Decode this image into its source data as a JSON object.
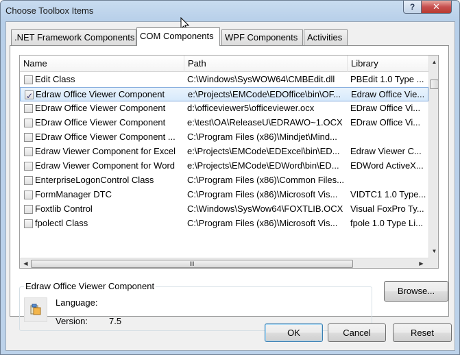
{
  "window": {
    "title": "Choose Toolbox Items",
    "help_label": "?",
    "close_label": "✕"
  },
  "tabs": [
    {
      "label": ".NET Framework Components",
      "active": false
    },
    {
      "label": "COM Components",
      "active": true
    },
    {
      "label": "WPF Components",
      "active": false
    },
    {
      "label": "Activities",
      "active": false
    }
  ],
  "list": {
    "columns": {
      "name": "Name",
      "path": "Path",
      "library": "Library"
    },
    "rows": [
      {
        "checked": false,
        "selected": false,
        "name": "Edit Class",
        "path": "C:\\Windows\\SysWOW64\\CMBEdit.dll",
        "library": "PBEdit 1.0 Type ..."
      },
      {
        "checked": true,
        "selected": true,
        "name": "Edraw Office Viewer Component",
        "path": "e:\\Projects\\EMCode\\EDOffice\\bin\\OF...",
        "library": "Edraw Office Vie..."
      },
      {
        "checked": false,
        "selected": false,
        "name": "EDraw Office Viewer Component",
        "path": "d:\\officeviewer5\\officeviewer.ocx",
        "library": "EDraw Office Vi..."
      },
      {
        "checked": false,
        "selected": false,
        "name": "EDraw Office Viewer Component",
        "path": "e:\\test\\OA\\ReleaseU\\EDRAWO~1.OCX",
        "library": "EDraw Office Vi..."
      },
      {
        "checked": false,
        "selected": false,
        "name": "EDraw Office Viewer Component ...",
        "path": "C:\\Program Files (x86)\\Mindjet\\Mind...",
        "library": ""
      },
      {
        "checked": false,
        "selected": false,
        "name": "Edraw Viewer Component for Excel",
        "path": "e:\\Projects\\EMCode\\EDExcel\\bin\\ED...",
        "library": "Edraw Viewer C..."
      },
      {
        "checked": false,
        "selected": false,
        "name": "Edraw Viewer Component for Word",
        "path": "e:\\Projects\\EMCode\\EDWord\\bin\\ED...",
        "library": "EDWord ActiveX..."
      },
      {
        "checked": false,
        "selected": false,
        "name": "EnterpriseLogonControl Class",
        "path": "C:\\Program Files (x86)\\Common Files...",
        "library": ""
      },
      {
        "checked": false,
        "selected": false,
        "name": "FormManager DTC",
        "path": "C:\\Program Files (x86)\\Microsoft Vis...",
        "library": "VIDTC1 1.0 Type..."
      },
      {
        "checked": false,
        "selected": false,
        "name": "Foxtlib Control",
        "path": "C:\\Windows\\SysWow64\\FOXTLIB.OCX",
        "library": "Visual FoxPro Ty..."
      },
      {
        "checked": false,
        "selected": false,
        "name": "fpolectl Class",
        "path": "C:\\Program Files (x86)\\Microsoft Vis...",
        "library": "fpole 1.0 Type Li..."
      }
    ],
    "hscroll_grip": "III"
  },
  "details": {
    "title": "Edraw Office Viewer Component",
    "language_label": "Language:",
    "language_value": "",
    "version_label": "Version:",
    "version_value": "7.5"
  },
  "buttons": {
    "browse": "Browse...",
    "ok": "OK",
    "cancel": "Cancel",
    "reset": "Reset"
  }
}
